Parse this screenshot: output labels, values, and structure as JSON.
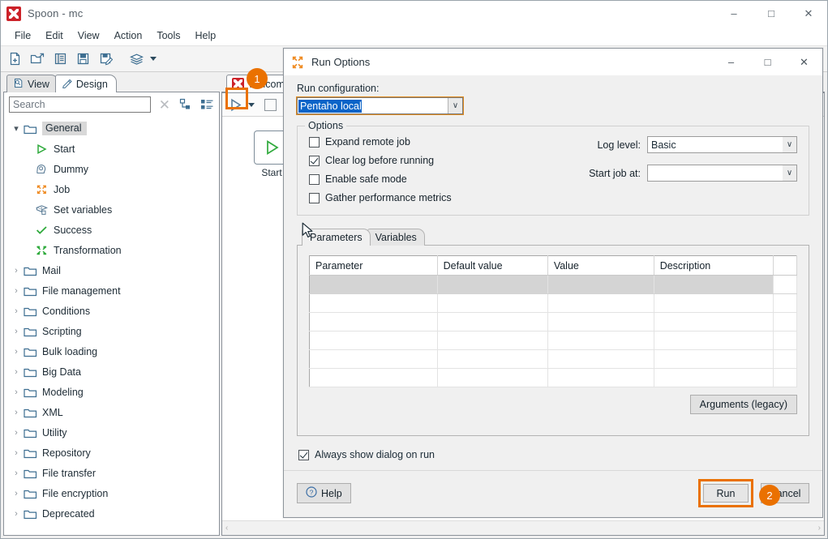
{
  "window": {
    "title": "Spoon - mc",
    "icon": "spoon-icon",
    "buttons": {
      "minimize": "–",
      "maximize": "□",
      "close": "✕"
    }
  },
  "menubar": {
    "items": [
      "File",
      "Edit",
      "View",
      "Action",
      "Tools",
      "Help"
    ]
  },
  "toolbar": {
    "items": [
      {
        "name": "new-file-icon",
        "title": "New"
      },
      {
        "name": "open-file-icon",
        "title": "Open"
      },
      {
        "name": "explore-repository-icon",
        "title": "Explore repository"
      },
      {
        "name": "save-icon",
        "title": "Save"
      },
      {
        "name": "save-as-icon",
        "title": "Save as"
      },
      {
        "name": "layers-icon",
        "title": "Perspectives"
      }
    ]
  },
  "left_panel": {
    "tabs": [
      {
        "label": "View",
        "icon": "view-icon",
        "active": false
      },
      {
        "label": "Design",
        "icon": "pencil-icon",
        "active": true
      }
    ],
    "search": {
      "placeholder": "Search",
      "value": ""
    },
    "search_actions": [
      {
        "name": "clear-search-icon",
        "label": "✕"
      },
      {
        "name": "expand-all-icon"
      },
      {
        "name": "collapse-all-icon"
      }
    ],
    "tree": [
      {
        "label": "General",
        "type": "folder",
        "expanded": true,
        "selected": true,
        "depth": 0
      },
      {
        "label": "Start",
        "type": "leaf",
        "icon": "start-icon",
        "depth": 1
      },
      {
        "label": "Dummy",
        "type": "leaf",
        "icon": "dummy-icon",
        "depth": 1
      },
      {
        "label": "Job",
        "type": "leaf",
        "icon": "job-icon",
        "depth": 1
      },
      {
        "label": "Set variables",
        "type": "leaf",
        "icon": "set-variables-icon",
        "depth": 1
      },
      {
        "label": "Success",
        "type": "leaf",
        "icon": "success-icon",
        "depth": 1
      },
      {
        "label": "Transformation",
        "type": "leaf",
        "icon": "transformation-icon",
        "depth": 1
      },
      {
        "label": "Mail",
        "type": "folder",
        "expanded": false,
        "depth": 0
      },
      {
        "label": "File management",
        "type": "folder",
        "expanded": false,
        "depth": 0
      },
      {
        "label": "Conditions",
        "type": "folder",
        "expanded": false,
        "depth": 0
      },
      {
        "label": "Scripting",
        "type": "folder",
        "expanded": false,
        "depth": 0
      },
      {
        "label": "Bulk loading",
        "type": "folder",
        "expanded": false,
        "depth": 0
      },
      {
        "label": "Big Data",
        "type": "folder",
        "expanded": false,
        "depth": 0
      },
      {
        "label": "Modeling",
        "type": "folder",
        "expanded": false,
        "depth": 0
      },
      {
        "label": "XML",
        "type": "folder",
        "expanded": false,
        "depth": 0
      },
      {
        "label": "Utility",
        "type": "folder",
        "expanded": false,
        "depth": 0
      },
      {
        "label": "Repository",
        "type": "folder",
        "expanded": false,
        "depth": 0
      },
      {
        "label": "File transfer",
        "type": "folder",
        "expanded": false,
        "depth": 0
      },
      {
        "label": "File encryption",
        "type": "folder",
        "expanded": false,
        "depth": 0
      },
      {
        "label": "Deprecated",
        "type": "folder",
        "expanded": false,
        "depth": 0
      }
    ]
  },
  "canvas": {
    "tab_label": "Welcome!",
    "toolbar": {
      "run": "run-icon",
      "run_dropdown": "chevron-down-icon",
      "stop": "stop-icon"
    },
    "nodes": [
      {
        "label": "Start",
        "icon": "start-icon"
      }
    ],
    "hscroll": {
      "left": "‹",
      "right": "›"
    }
  },
  "dialog": {
    "title": "Run Options",
    "icon": "job-icon",
    "buttons": {
      "minimize": "–",
      "maximize": "□",
      "close": "✕"
    },
    "run_configuration": {
      "label": "Run configuration:",
      "value": "Pentaho local",
      "arrow": "∨"
    },
    "options": {
      "legend": "Options",
      "checkboxes": [
        {
          "label": "Expand remote job",
          "checked": false
        },
        {
          "label": "Clear log before running",
          "checked": true
        },
        {
          "label": "Enable safe mode",
          "checked": false
        },
        {
          "label": "Gather performance metrics",
          "checked": false
        }
      ],
      "log_level": {
        "label": "Log level:",
        "value": "Basic",
        "arrow": "∨"
      },
      "start_job_at": {
        "label": "Start job at:",
        "value": "",
        "arrow": "∨"
      }
    },
    "param_tabs": [
      {
        "label": "Parameters",
        "active": true
      },
      {
        "label": "Variables",
        "active": false
      }
    ],
    "param_table": {
      "columns": [
        "Parameter",
        "Default value",
        "Value",
        "Description"
      ],
      "rows": [
        {
          "selected": true,
          "cells": [
            "",
            "",
            "",
            ""
          ]
        },
        {
          "selected": false,
          "cells": [
            "",
            "",
            "",
            ""
          ]
        },
        {
          "selected": false,
          "cells": [
            "",
            "",
            "",
            ""
          ]
        },
        {
          "selected": false,
          "cells": [
            "",
            "",
            "",
            ""
          ]
        },
        {
          "selected": false,
          "cells": [
            "",
            "",
            "",
            ""
          ]
        },
        {
          "selected": false,
          "cells": [
            "",
            "",
            "",
            ""
          ]
        }
      ]
    },
    "arguments_button": "Arguments (legacy)",
    "always_show": {
      "label": "Always show dialog on run",
      "checked": true
    },
    "footer": {
      "help": "Help",
      "help_icon": "question-icon",
      "run": "Run",
      "cancel": "Cancel"
    }
  },
  "annotations": [
    {
      "id": "1",
      "target": "run-toolbar-button"
    },
    {
      "id": "2",
      "target": "cancel-button"
    }
  ],
  "colors": {
    "accent_orange": "#ea7100",
    "selection_blue": "#0a64c8",
    "brand_red": "#cc2229",
    "icon_blue": "#3d6e91",
    "green": "#2faa3c"
  }
}
